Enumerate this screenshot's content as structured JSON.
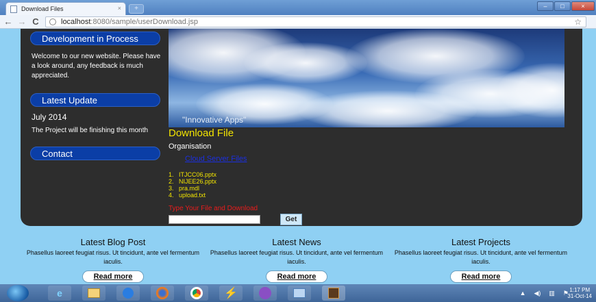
{
  "browser": {
    "tab_title": "Download Files",
    "tab_close": "×",
    "new_tab": "+",
    "win_min": "–",
    "win_max": "□",
    "win_close": "×",
    "back": "←",
    "forward": "→",
    "reload": "C",
    "url_host": "localhost",
    "url_path": ":8080/sample/userDownload.jsp",
    "star": "☆"
  },
  "sidebar": {
    "dev_title": "Development in Process",
    "dev_text": "Welcome to our new website. Please have a look around, any feedback is much appreciated.",
    "update_title": "Latest Update",
    "update_date": "July 2014",
    "update_text": "The Project will be finishing this month",
    "contact_title": "Contact"
  },
  "hero": {
    "caption": "\"Innovative Apps\""
  },
  "download": {
    "title": "Download File",
    "org_label": "Organisation",
    "cloud_link": "Cloud Server Files",
    "files": [
      "ITJCC06.pptx",
      "NIJEE26.pptx",
      "pra.mdl",
      "upload.txt"
    ],
    "type_label": "Type Your File and Download",
    "input_value": "",
    "get_label": "Get"
  },
  "footer": [
    {
      "title": "Latest Blog Post",
      "text": "Phasellus laoreet feugiat risus. Ut tincidunt, ante vel fermentum iaculis.",
      "link": "Read more"
    },
    {
      "title": "Latest News",
      "text": "Phasellus laoreet feugiat risus. Ut tincidunt, ante vel fermentum iaculis.",
      "link": "Read more"
    },
    {
      "title": "Latest Projects",
      "text": "Phasellus laoreet feugiat risus. Ut tincidunt, ante vel fermentum iaculis.",
      "link": "Read more"
    }
  ],
  "taskbar": {
    "icons": [
      "ie-icon",
      "explorer-icon",
      "media-player-icon",
      "firefox-icon",
      "chrome-icon",
      "eclipse-icon",
      "mozilla-icon",
      "notepad-icon",
      "app-icon"
    ],
    "time": "1:17 PM",
    "date": "31-Oct-14"
  }
}
